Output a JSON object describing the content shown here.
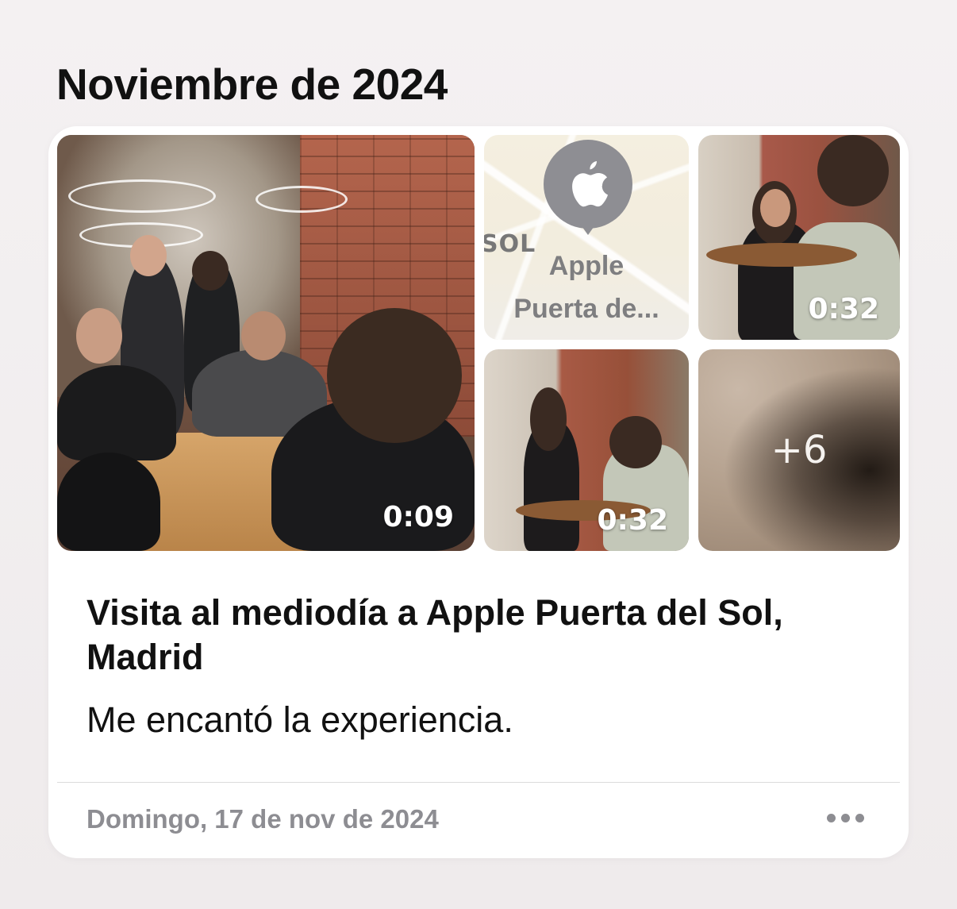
{
  "section": {
    "title": "Noviembre de 2024"
  },
  "entry": {
    "title": "Visita al mediodía a Apple Puerta del Sol, Madrid",
    "body": "Me encantó la experiencia.",
    "date": "Domingo, 17 de nov de 2024",
    "more_icon": "ellipsis-icon",
    "media": {
      "main_video_duration": "0:09",
      "map": {
        "icon": "apple-logo-icon",
        "street_label": "SOL",
        "place_line1": "Apple",
        "place_line2": "Puerta de..."
      },
      "video2_duration": "0:32",
      "video3_duration": "0:32",
      "more_count": "+6"
    }
  }
}
